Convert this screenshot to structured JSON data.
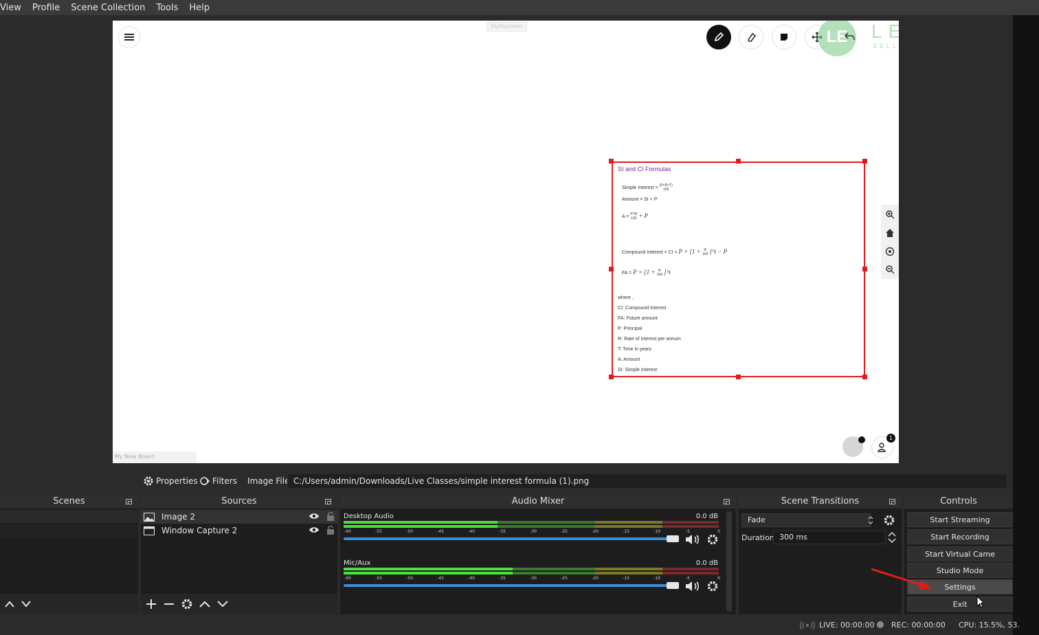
{
  "menu": [
    "View",
    "Profile",
    "Scene Collection",
    "Tools",
    "Help"
  ],
  "preview": {
    "fullscreen_label": "Fullscreen",
    "board_name": "My New Board",
    "logo": {
      "mark": "LE",
      "name": "LEARNYST",
      "tagline": "SELL COURSES ONLINE"
    },
    "participants_badge": "1",
    "formula_card": {
      "title": "SI and CI Formulas",
      "lines": {
        "si_label": "Simple Interest =",
        "si_num": "(P×R×T)",
        "si_den": "100",
        "amount": "Amount = SI + P",
        "a_label": "A =",
        "a_num": "PTR",
        "a_den": "100",
        "a_tail": "+ P",
        "ci_label": "Compound Interest = CI =",
        "ci_expr": "P × [1 + ",
        "ci_num": "R",
        "ci_den": "100",
        "ci_tail": "]^t − P",
        "fa_label": "FA =",
        "fa_expr": "P × [1 + ",
        "fa_num": "R",
        "fa_den": "100",
        "fa_tail": "]^t",
        "where": "where ,",
        "d1": "CI: Compound Interest",
        "d2": "FA: Future amount",
        "d3": "P: Principal",
        "d4": "R: Rate of interest per annum",
        "d5": "T: Time in years",
        "d6": "A: Amount",
        "d7": "SI: Simple Interest"
      }
    }
  },
  "context_bar": {
    "properties": "Properties",
    "filters": "Filters",
    "source_type": "Image File",
    "path": "C:/Users/admin/Downloads/Live Classes/simple interest formula (1).png"
  },
  "docks": {
    "scenes": {
      "title": "Scenes"
    },
    "sources": {
      "title": "Sources",
      "items": [
        {
          "name": "Image 2",
          "icon": "image-icon"
        },
        {
          "name": "Window Capture 2",
          "icon": "window-icon"
        }
      ]
    },
    "mixer": {
      "title": "Audio Mixer",
      "channels": [
        {
          "name": "Desktop Audio",
          "db": "0.0 dB",
          "level": 0.41
        },
        {
          "name": "Mic/Aux",
          "db": "0.0 dB",
          "level": 0.45
        }
      ],
      "ticks": [
        "-60",
        "-55",
        "-50",
        "-45",
        "-40",
        "-35",
        "-30",
        "-25",
        "-20",
        "-15",
        "-10",
        "-5",
        "0"
      ]
    },
    "transitions": {
      "title": "Scene Transitions",
      "selected": "Fade",
      "duration_label": "Duration",
      "duration": "300 ms"
    },
    "controls": {
      "title": "Controls",
      "buttons": [
        "Start Streaming",
        "Start Recording",
        "Start Virtual Came",
        "Studio Mode",
        "Settings",
        "Exit"
      ]
    }
  },
  "status": {
    "live": "LIVE: 00:00:00",
    "rec": "REC: 00:00:00",
    "cpu": "CPU: 15.5%, 53."
  },
  "colors": {
    "accent_red": "#e31b1b",
    "meter_green": "#4de03c",
    "volume_blue": "#3a8fd9"
  }
}
